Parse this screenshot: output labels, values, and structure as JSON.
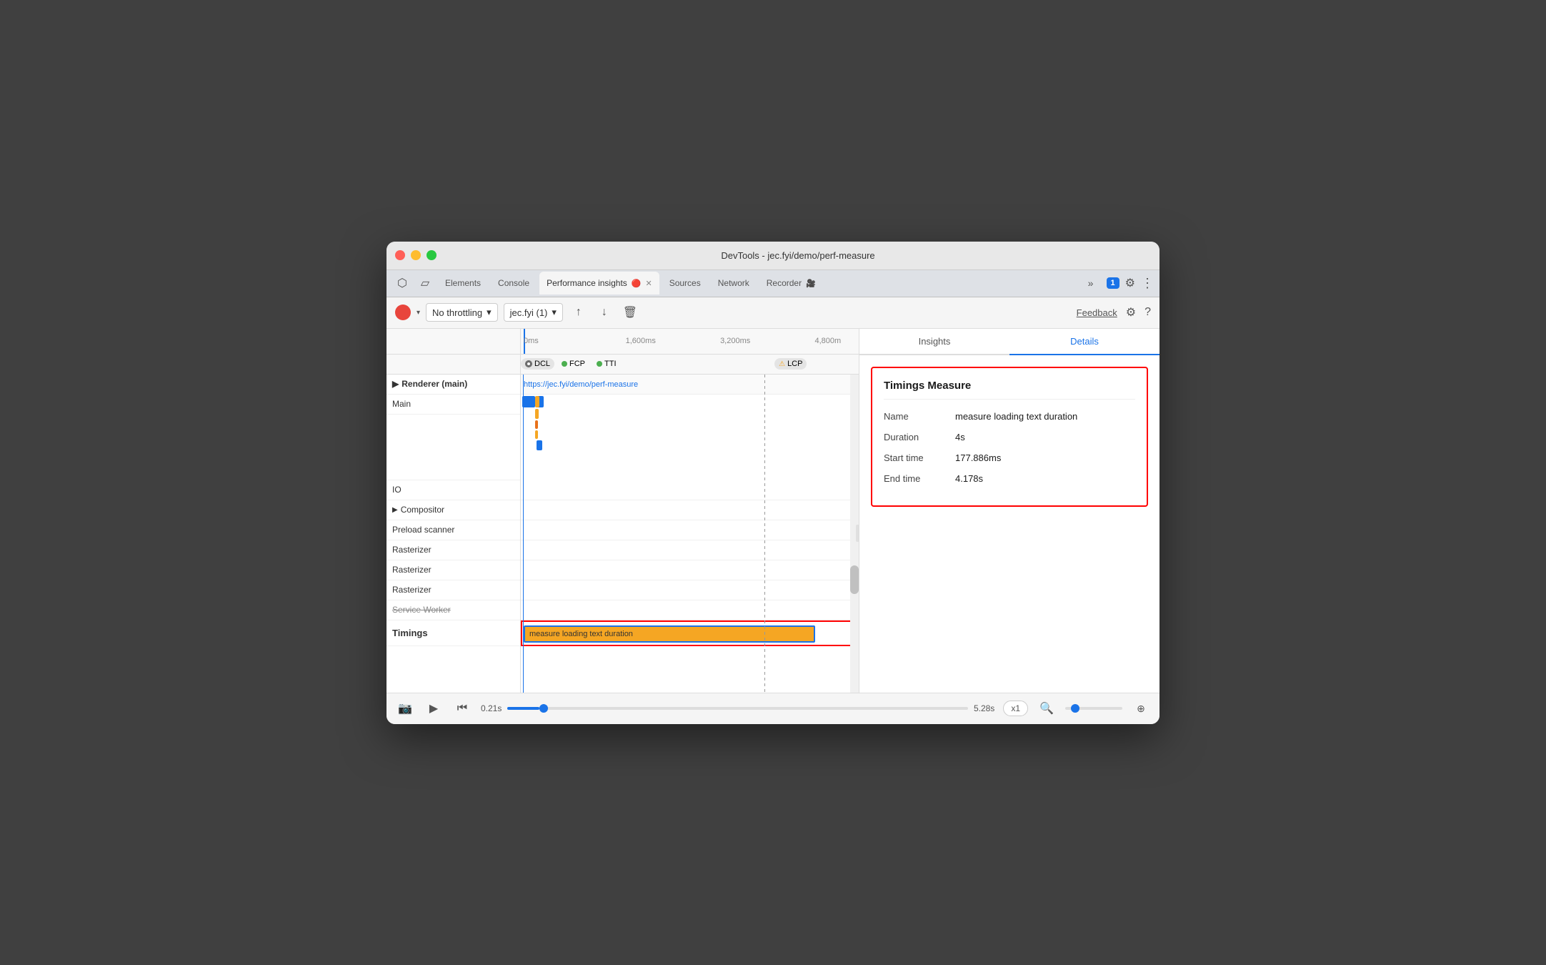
{
  "window": {
    "title": "DevTools - jec.fyi/demo/perf-measure"
  },
  "tabs": {
    "items": [
      {
        "label": "Elements",
        "active": false
      },
      {
        "label": "Console",
        "active": false
      },
      {
        "label": "Performance insights",
        "active": true,
        "has_icon": true
      },
      {
        "label": "Sources",
        "active": false
      },
      {
        "label": "Network",
        "active": false
      },
      {
        "label": "Recorder",
        "active": false
      }
    ],
    "more_label": "»",
    "chat_badge": "1"
  },
  "toolbar": {
    "throttle_label": "No throttling",
    "session_label": "jec.fyi (1)",
    "feedback_label": "Feedback",
    "upload_icon": "↑",
    "download_icon": "↓",
    "delete_icon": "🗑"
  },
  "timeline": {
    "markers": [
      {
        "label": "0ms",
        "pos_pct": 0
      },
      {
        "label": "1,600ms",
        "pos_pct": 30
      },
      {
        "label": "3,200ms",
        "pos_pct": 58
      },
      {
        "label": "4,800m",
        "pos_pct": 86
      }
    ],
    "event_markers": [
      {
        "label": "DCL",
        "type": "circle",
        "color": "#9e9e9e"
      },
      {
        "label": "FCP",
        "type": "dot",
        "color": "#4CAF50"
      },
      {
        "label": "TTI",
        "type": "dot",
        "color": "#4CAF50"
      },
      {
        "label": "LCP",
        "type": "triangle",
        "color": "#f5a623"
      }
    ],
    "url": "https://jec.fyi/demo/perf-measure"
  },
  "tracks": {
    "renderer_label": "Renderer (main)",
    "main_label": "Main",
    "io_label": "IO",
    "compositor_label": "Compositor",
    "preload_label": "Preload scanner",
    "rasterizer_labels": [
      "Rasterizer",
      "Rasterizer",
      "Rasterizer"
    ],
    "service_worker_label": "Service Worker",
    "timings_label": "Timings"
  },
  "timing_bar": {
    "label": "measure loading text duration",
    "color": "#f5a623"
  },
  "right_panel": {
    "tabs": [
      {
        "label": "Insights",
        "active": false
      },
      {
        "label": "Details",
        "active": true
      }
    ],
    "details": {
      "title": "Timings Measure",
      "rows": [
        {
          "label": "Name",
          "value": "measure loading text duration"
        },
        {
          "label": "Duration",
          "value": "4s"
        },
        {
          "label": "Start time",
          "value": "177.886ms"
        },
        {
          "label": "End time",
          "value": "4.178s"
        }
      ]
    }
  },
  "bottom_bar": {
    "start_time": "0.21s",
    "end_time": "5.28s",
    "zoom_label": "x1",
    "slider_pct": 7
  }
}
